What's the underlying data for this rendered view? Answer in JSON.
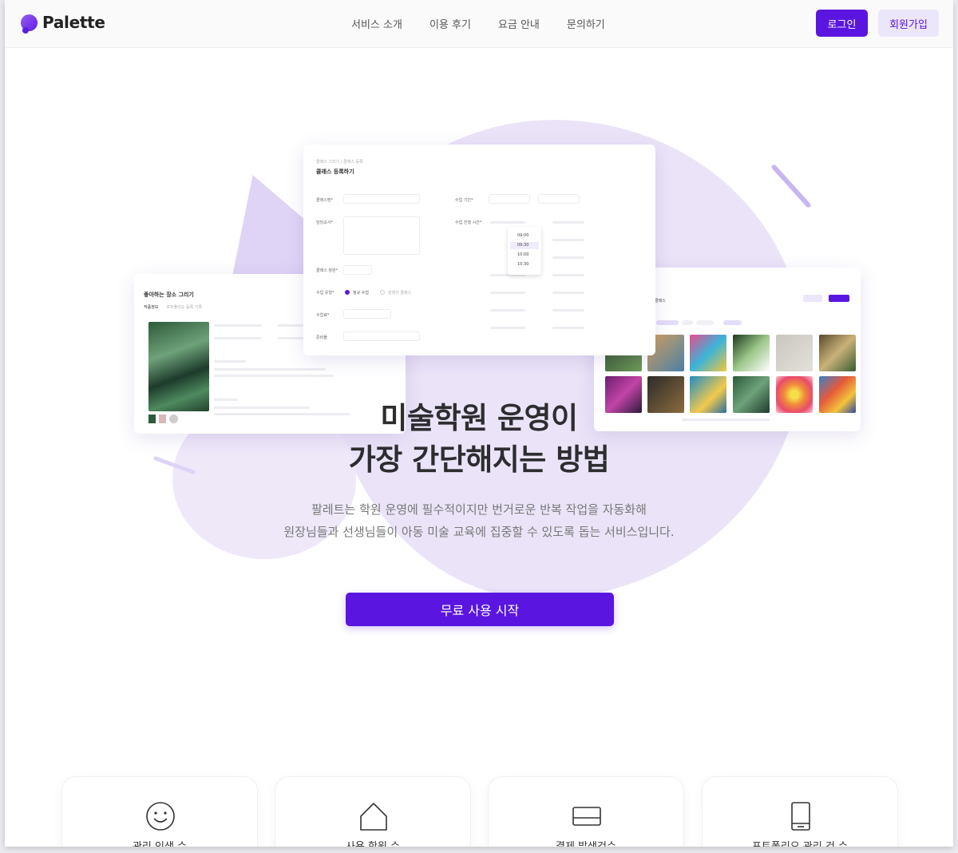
{
  "brand": {
    "name": "Palette",
    "accent": "#5a16e0",
    "light_accent": "#ece6fb"
  },
  "nav": {
    "items": [
      "서비스 소개",
      "이용 후기",
      "요금 안내",
      "문의하기"
    ],
    "login": "로그인",
    "signup": "회원가입"
  },
  "hero": {
    "headline_line1": "미술학원 운영이",
    "headline_line2": "가장 간단해지는 방법",
    "description_line1": "팔레트는 학원 운영에 필수적이지만 번거로운 반복 작업을 자동화해",
    "description_line2": "원장님들과 선생님들이 아동 미술 교육에 집중할 수 있도록 돕는 서비스입니다.",
    "cta": "무료 사용 시작"
  },
  "preview": {
    "center_breadcrumb": "클래스 그리기 / 클래스 등록",
    "center_title": "클래스 등록하기",
    "center_rows": [
      "클래스명*",
      "담당교사*",
      "클래스 정원*",
      "수업 유형*",
      "수업료*",
      "준비물"
    ],
    "center_right_rows": [
      "수업 기간*",
      "수업 진행 시간*"
    ],
    "center_options": [
      "정규 수업",
      "원데이 클래스"
    ],
    "center_times": [
      "09:00",
      "09:30",
      "10:00",
      "10:30"
    ],
    "left_title": "좋아하는 장소 그리기",
    "left_tabs": [
      "작품정보",
      "포트폴리오 등록 기록"
    ],
    "right_title": "클래스"
  },
  "features": [
    {
      "icon": "smile-icon",
      "label": "관리 인생 수"
    },
    {
      "icon": "home-icon",
      "label": "사용 학원 수"
    },
    {
      "icon": "card-icon",
      "label": "결제 발생건수"
    },
    {
      "icon": "book-icon",
      "label": "포트폴리오 관리 건 수"
    }
  ]
}
